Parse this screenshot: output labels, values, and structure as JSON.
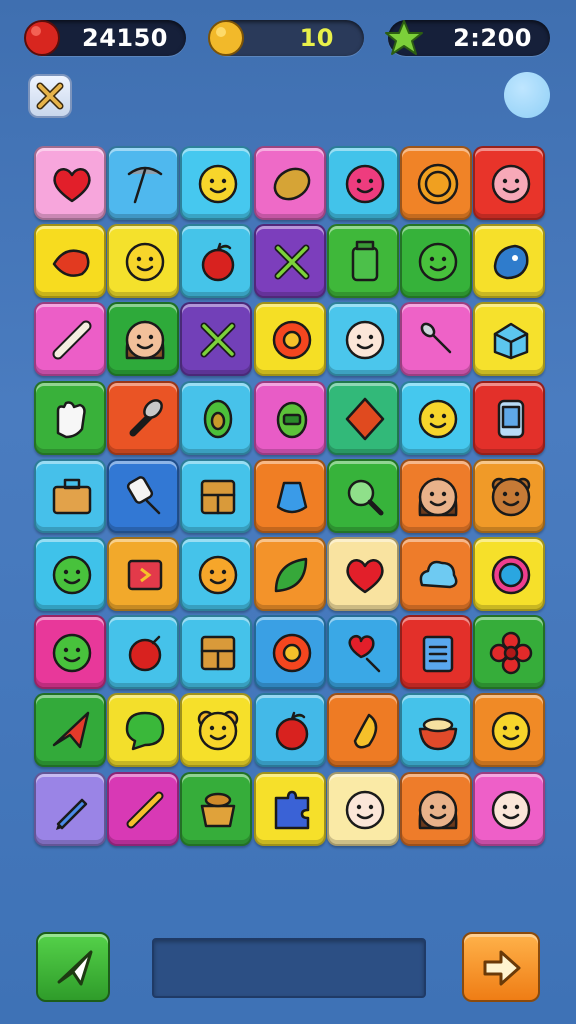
{
  "hud": {
    "lives": {
      "value": "24150",
      "icon": "heart-icon",
      "color": "#e0302a"
    },
    "coins": {
      "value": "10",
      "icon": "coin-icon",
      "color": "#f0b82a"
    },
    "stars": {
      "value": "2:200",
      "icon": "star-icon",
      "color": "#7ccf3a"
    }
  },
  "controls": {
    "close_icon": "close-icon",
    "round_button": "bubble-button",
    "hint_icon": "paper-plane-icon",
    "next_icon": "arrow-right-icon"
  },
  "board": {
    "columns": 7,
    "rows": 9,
    "tiles": [
      {
        "icon": "heart-icon",
        "bg": "#f7a6dc"
      },
      {
        "icon": "pickaxe-icon",
        "bg": "#4fb8ee"
      },
      {
        "icon": "smiley-icon",
        "bg": "#46c8ef"
      },
      {
        "icon": "potato-icon",
        "bg": "#ee6ac7"
      },
      {
        "icon": "berry-face-icon",
        "bg": "#42c3ea"
      },
      {
        "icon": "coin-face-icon",
        "bg": "#f08327"
      },
      {
        "icon": "pig-face-icon",
        "bg": "#e8342a"
      },
      {
        "icon": "fire-fish-icon",
        "bg": "#f7dc1f"
      },
      {
        "icon": "smiley-icon",
        "bg": "#f4e12c"
      },
      {
        "icon": "apple-icon",
        "bg": "#45c4e9"
      },
      {
        "icon": "crossed-tools-icon",
        "bg": "#7c3ebc"
      },
      {
        "icon": "jar-icon",
        "bg": "#3fb83a"
      },
      {
        "icon": "green-face-icon",
        "bg": "#36b23a"
      },
      {
        "icon": "blue-creature-icon",
        "bg": "#f6e02a"
      },
      {
        "icon": "rolling-pin-icon",
        "bg": "#ec5ec7"
      },
      {
        "icon": "girl-face-icon",
        "bg": "#2eaa3a"
      },
      {
        "icon": "crossed-tools-icon",
        "bg": "#7240b8"
      },
      {
        "icon": "sun-flower-icon",
        "bg": "#f5df25"
      },
      {
        "icon": "baby-face-icon",
        "bg": "#4bc6ec"
      },
      {
        "icon": "whisk-icon",
        "bg": "#ee62c7"
      },
      {
        "icon": "ice-cube-icon",
        "bg": "#f6e12c"
      },
      {
        "icon": "glove-icon",
        "bg": "#39b13a"
      },
      {
        "icon": "spatula-icon",
        "bg": "#ea5425"
      },
      {
        "icon": "avocado-icon",
        "bg": "#47c2ea"
      },
      {
        "icon": "robot-icon",
        "bg": "#e85cc6"
      },
      {
        "icon": "diamond-leaf-icon",
        "bg": "#32b979"
      },
      {
        "icon": "hat-face-icon",
        "bg": "#45c8ee"
      },
      {
        "icon": "phone-icon",
        "bg": "#e3302a"
      },
      {
        "icon": "briefcase-icon",
        "bg": "#46c0ea"
      },
      {
        "icon": "roller-icon",
        "bg": "#3278d4"
      },
      {
        "icon": "cabinet-icon",
        "bg": "#45c3ea"
      },
      {
        "icon": "bottle-icon",
        "bg": "#f07e24"
      },
      {
        "icon": "magnifier-icon",
        "bg": "#37b33b"
      },
      {
        "icon": "woman-face-icon",
        "bg": "#ee7c2a"
      },
      {
        "icon": "bear-face-icon",
        "bg": "#f09a28"
      },
      {
        "icon": "green-face-icon",
        "bg": "#3fc2ea"
      },
      {
        "icon": "box-icon",
        "bg": "#f2a92b"
      },
      {
        "icon": "orange-creature-icon",
        "bg": "#45c3ea"
      },
      {
        "icon": "leaf-icon",
        "bg": "#f3932a"
      },
      {
        "icon": "heart-icon",
        "bg": "#f9e3a0"
      },
      {
        "icon": "cloud-face-icon",
        "bg": "#ee7c2a"
      },
      {
        "icon": "ring-icon",
        "bg": "#f6e02a"
      },
      {
        "icon": "green-face-icon",
        "bg": "#e8389a"
      },
      {
        "icon": "red-ball-icon",
        "bg": "#45c2ea"
      },
      {
        "icon": "cabinet-icon",
        "bg": "#45c2ea"
      },
      {
        "icon": "sun-flower-icon",
        "bg": "#3aa0e4"
      },
      {
        "icon": "heart-lollipop-icon",
        "bg": "#3aa8e6"
      },
      {
        "icon": "clipboard-icon",
        "bg": "#e3302a"
      },
      {
        "icon": "flower-icon",
        "bg": "#36ad3a"
      },
      {
        "icon": "plane-icon",
        "bg": "#33aa3a"
      },
      {
        "icon": "chat-bubble-icon",
        "bg": "#f3df2b"
      },
      {
        "icon": "mouse-face-icon",
        "bg": "#f6e02a"
      },
      {
        "icon": "apple-icon",
        "bg": "#43b9e8"
      },
      {
        "icon": "pepper-icon",
        "bg": "#ee7b24"
      },
      {
        "icon": "bowl-icon",
        "bg": "#45c2ea"
      },
      {
        "icon": "smiley-icon",
        "bg": "#f08a26"
      },
      {
        "icon": "pen-icon",
        "bg": "#9a84e6"
      },
      {
        "icon": "candy-icon",
        "bg": "#d839b5"
      },
      {
        "icon": "pot-icon",
        "bg": "#36ad3a"
      },
      {
        "icon": "puzzle-icon",
        "bg": "#f6e02a"
      },
      {
        "icon": "baby-face-icon",
        "bg": "#faeaa6"
      },
      {
        "icon": "woman-face-icon",
        "bg": "#ee7c2a"
      },
      {
        "icon": "baby-face-icon",
        "bg": "#ee5fc8"
      }
    ]
  }
}
